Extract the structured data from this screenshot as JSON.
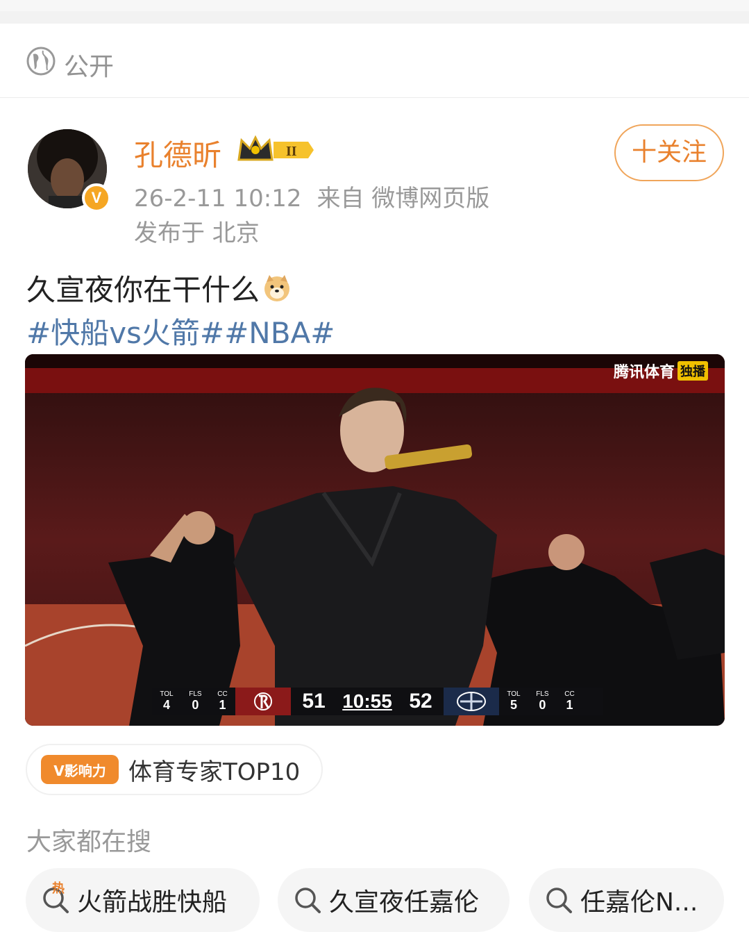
{
  "privacy": {
    "label": "公开"
  },
  "author": {
    "name": "孔德昕",
    "level_badge": "II",
    "verified_badge": "V",
    "time": "26-2-11 10:12",
    "source": "来自 微博网页版",
    "location": "发布于 北京"
  },
  "follow": {
    "label": "十关注"
  },
  "post": {
    "text": "久宣夜你在干什么",
    "tags": "#快船vs火箭##NBA#"
  },
  "media": {
    "watermark": "腾讯体育",
    "watermark_tag": "独播",
    "scoreboard": {
      "left_stats": [
        {
          "label": "TOL",
          "value": "4"
        },
        {
          "label": "FLS",
          "value": "0"
        },
        {
          "label": "CC",
          "value": "1"
        }
      ],
      "left_score": "51",
      "clock": "10:55",
      "right_score": "52",
      "right_stats": [
        {
          "label": "TOL",
          "value": "5"
        },
        {
          "label": "FLS",
          "value": "0"
        },
        {
          "label": "CC",
          "value": "1"
        }
      ]
    }
  },
  "influence": {
    "badge": "V影响力",
    "text": "体育专家TOP10"
  },
  "search": {
    "title": "大家都在搜",
    "chips": [
      {
        "label": "火箭战胜快船",
        "hot": "热"
      },
      {
        "label": "久宣夜任嘉伦"
      },
      {
        "label": "任嘉伦N..."
      }
    ]
  },
  "colors": {
    "accent": "#e9812d",
    "topic_link": "#5078a8",
    "muted": "#999999"
  }
}
